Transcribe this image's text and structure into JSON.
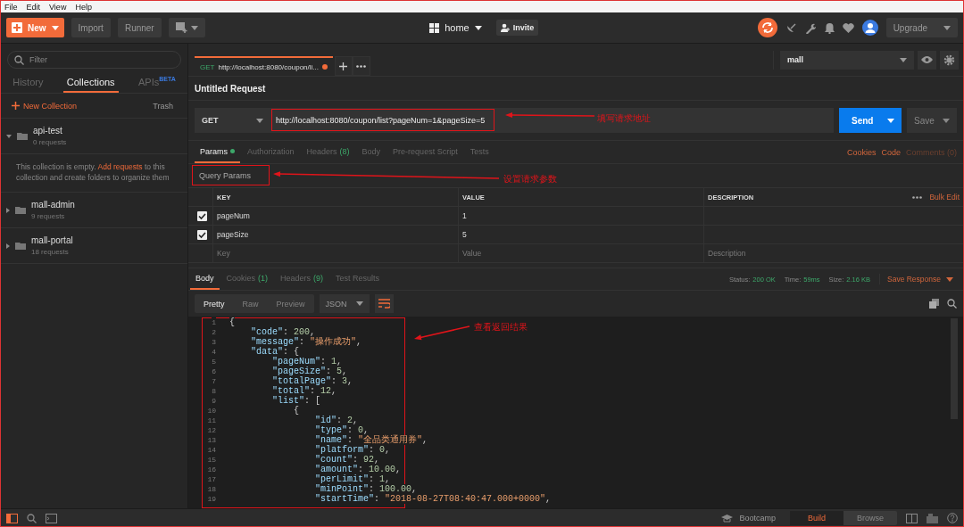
{
  "menu": [
    "File",
    "Edit",
    "View",
    "Help"
  ],
  "header": {
    "new_label": "New",
    "buttons": [
      "Import",
      "Runner"
    ],
    "workspace": "home",
    "invite": "Invite",
    "upgrade": "Upgrade"
  },
  "sidebar": {
    "filter_placeholder": "Filter",
    "tabs": [
      {
        "label": "History",
        "selected": false
      },
      {
        "label": "Collections",
        "selected": true
      },
      {
        "label": "APIs",
        "badge": "BETA",
        "selected": false
      }
    ],
    "new_collection": "New Collection",
    "trash": "Trash",
    "collections": [
      {
        "name": "api-test",
        "count": "0 requests",
        "expanded": true,
        "note_before": "This collection is empty.",
        "note_link": "Add requests",
        "note_after": "to this collection and create folders to organize them"
      },
      {
        "name": "mall-admin",
        "count": "9 requests",
        "expanded": false
      },
      {
        "name": "mall-portal",
        "count": "18 requests",
        "expanded": false
      }
    ]
  },
  "request_tab": {
    "method": "GET",
    "title": "http://localhost:8080/coupon/li...",
    "unsaved": true
  },
  "environment": "mall",
  "request": {
    "title": "Untitled Request",
    "method": "GET",
    "url": "http://localhost:8080/coupon/list?pageNum=1&pageSize=5",
    "send": "Send",
    "save": "Save"
  },
  "request_tabs": [
    {
      "label": "Params",
      "dot": true,
      "selected": true
    },
    {
      "label": "Authorization",
      "selected": false
    },
    {
      "label": "Headers",
      "count": "(8)",
      "selected": false
    },
    {
      "label": "Body",
      "selected": false
    },
    {
      "label": "Pre-request Script",
      "selected": false
    },
    {
      "label": "Tests",
      "selected": false
    }
  ],
  "request_links": [
    {
      "label": "Cookies",
      "disabled": false
    },
    {
      "label": "Code",
      "disabled": false
    },
    {
      "label": "Comments (0)",
      "disabled": true
    }
  ],
  "query_params": {
    "title": "Query Params",
    "columns": [
      "KEY",
      "VALUE",
      "DESCRIPTION"
    ],
    "bulk_edit": "Bulk Edit",
    "rows": [
      {
        "key": "pageNum",
        "value": "1",
        "checked": true
      },
      {
        "key": "pageSize",
        "value": "5",
        "checked": true
      }
    ],
    "placeholders": {
      "key": "Key",
      "value": "Value",
      "description": "Description"
    }
  },
  "response_tabs": [
    {
      "label": "Body",
      "selected": true
    },
    {
      "label": "Cookies",
      "count": "(1)",
      "selected": false
    },
    {
      "label": "Headers",
      "count": "(9)",
      "selected": false
    },
    {
      "label": "Test Results",
      "selected": false
    }
  ],
  "response_meta": [
    {
      "label": "Status:",
      "value": "200 OK"
    },
    {
      "label": "Time:",
      "value": "59ms"
    },
    {
      "label": "Size:",
      "value": "2.16 KB"
    }
  ],
  "save_response": "Save Response",
  "view_modes": [
    {
      "label": "Pretty",
      "selected": true
    },
    {
      "label": "Raw",
      "selected": false
    },
    {
      "label": "Preview",
      "selected": false
    }
  ],
  "format": "JSON",
  "code_lines": [
    {
      "num": "1",
      "text": "{"
    },
    {
      "num": "2",
      "text": "    \"code\": 200,"
    },
    {
      "num": "3",
      "text": "    \"message\": \"操作成功\","
    },
    {
      "num": "4",
      "text": "    \"data\": {"
    },
    {
      "num": "5",
      "text": "        \"pageNum\": 1,"
    },
    {
      "num": "6",
      "text": "        \"pageSize\": 5,"
    },
    {
      "num": "7",
      "text": "        \"totalPage\": 3,"
    },
    {
      "num": "8",
      "text": "        \"total\": 12,"
    },
    {
      "num": "9",
      "text": "        \"list\": ["
    },
    {
      "num": "10",
      "text": "            {"
    },
    {
      "num": "11",
      "text": "                \"id\": 2,"
    },
    {
      "num": "12",
      "text": "                \"type\": 0,"
    },
    {
      "num": "13",
      "text": "                \"name\": \"全品类通用券\","
    },
    {
      "num": "14",
      "text": "                \"platform\": 0,"
    },
    {
      "num": "15",
      "text": "                \"count\": 92,"
    },
    {
      "num": "16",
      "text": "                \"amount\": 10.00,"
    },
    {
      "num": "17",
      "text": "                \"perLimit\": 1,"
    },
    {
      "num": "18",
      "text": "                \"minPoint\": 100.00,"
    },
    {
      "num": "19",
      "text": "                \"startTime\": \"2018-08-27T08:40:47.000+0000\","
    }
  ],
  "footer": {
    "bootcamp": "Bootcamp",
    "modes": [
      {
        "label": "Build",
        "selected": true
      },
      {
        "label": "Browse",
        "selected": false
      }
    ]
  },
  "annotations": [
    {
      "text": "填写请求地址"
    },
    {
      "text": "设置请求参数"
    },
    {
      "text": "查看返回结果"
    }
  ]
}
